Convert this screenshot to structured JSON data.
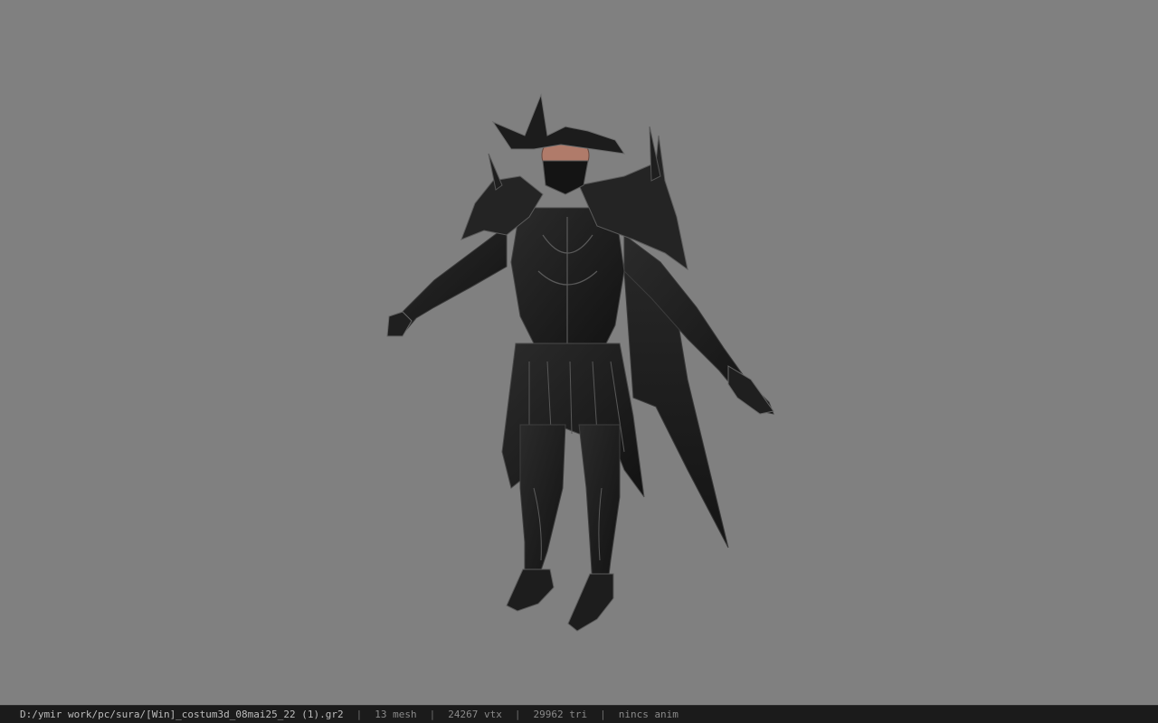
{
  "viewer": {
    "background_color": "#808080"
  },
  "status_bar": {
    "file_path": "D:/ymir work/pc/sura/[Win]_costum3d_08mai25_22 (1).gr2",
    "separator": "|",
    "mesh_count": "13 mesh",
    "vertex_count": "24267 vtx",
    "triangle_count": "29962 tri",
    "animation": "nincs anim"
  }
}
